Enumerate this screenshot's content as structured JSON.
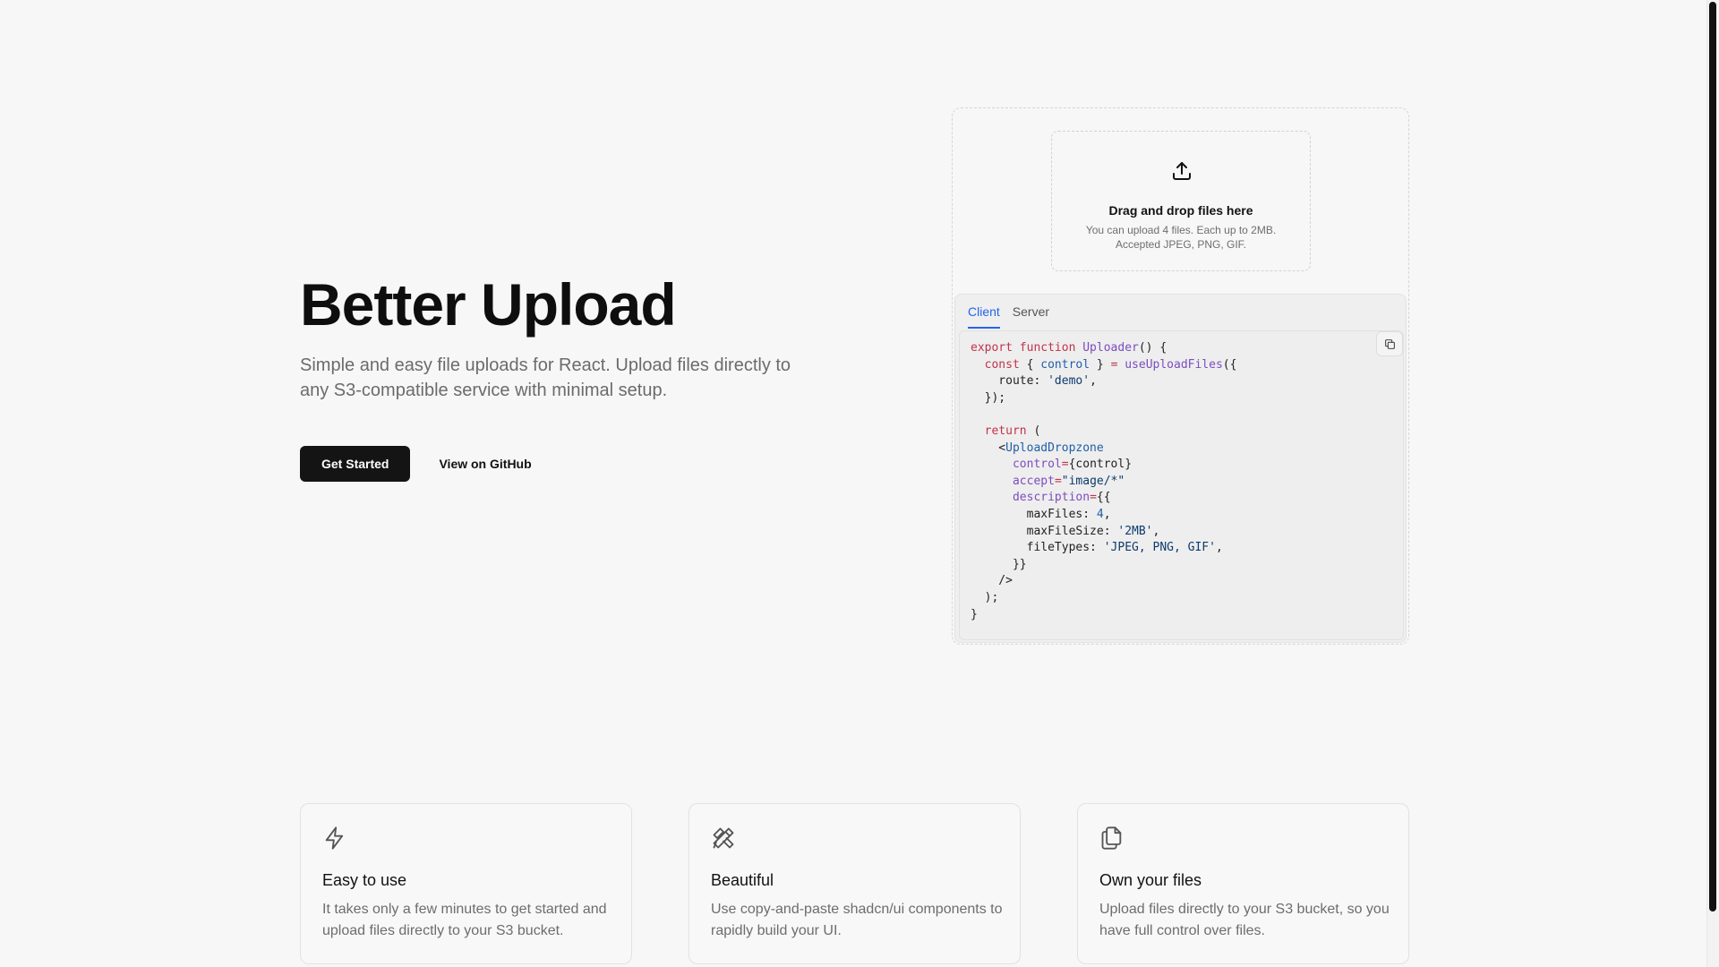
{
  "hero": {
    "title": "Better Upload",
    "subtitle": "Simple and easy file uploads for React. Upload files directly to any S3-compatible service with minimal setup.",
    "primary_button": "Get Started",
    "secondary_button": "View on GitHub"
  },
  "demo": {
    "dropzone": {
      "icon": "upload-icon",
      "title": "Drag and drop files here",
      "description_line1": "You can upload 4 files. Each up to 2MB.",
      "description_line2": "Accepted JPEG, PNG, GIF."
    },
    "tabs": [
      {
        "label": "Client",
        "active": true
      },
      {
        "label": "Server",
        "active": false
      }
    ],
    "copy_icon": "copy-icon"
  },
  "features": [
    {
      "icon": "lightning-icon",
      "title": "Easy to use",
      "description": "It takes only a few minutes to get started and upload files directly to your S3 bucket."
    },
    {
      "icon": "design-tools-icon",
      "title": "Beautiful",
      "description": "Use copy-and-paste shadcn/ui components to rapidly build your UI."
    },
    {
      "icon": "files-icon",
      "title": "Own your files",
      "description": "Upload files directly to your S3 bucket, so you have full control over files."
    }
  ],
  "colors": {
    "accent": "#2563eb",
    "primary_button_bg": "#141414",
    "background": "#f7f7f7"
  }
}
